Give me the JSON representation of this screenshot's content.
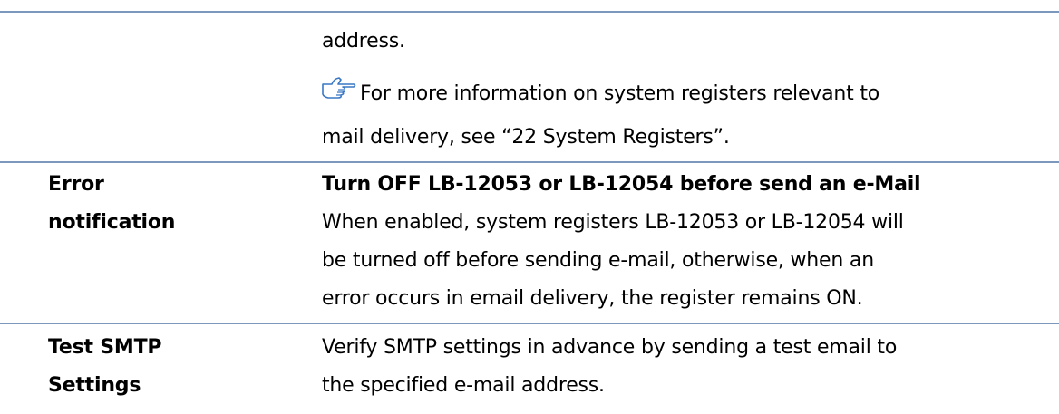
{
  "row1": {
    "line1": "address.",
    "note_line1": "For more information on system registers relevant to",
    "note_line2": "mail delivery, see “22 System Registers”."
  },
  "row2": {
    "label_line1": "Error",
    "label_line2": "notification",
    "heading": "Turn OFF LB-12053 or LB-12054 before send an e-Mail",
    "desc_line1": "When enabled, system registers LB-12053 or LB-12054 will",
    "desc_line2": "be turned off before sending e-mail, otherwise, when an",
    "desc_line3": "error occurs in email delivery, the register remains ON."
  },
  "row3": {
    "label_line1": "Test SMTP",
    "label_line2": "Settings",
    "desc_line1": "Verify SMTP settings in advance by sending a test email to",
    "desc_line2": "the specified e-mail address."
  },
  "icons": {
    "note": "pointing-hand-icon"
  },
  "colors": {
    "rule": "#7d98bd",
    "icon": "#3a78c4"
  }
}
